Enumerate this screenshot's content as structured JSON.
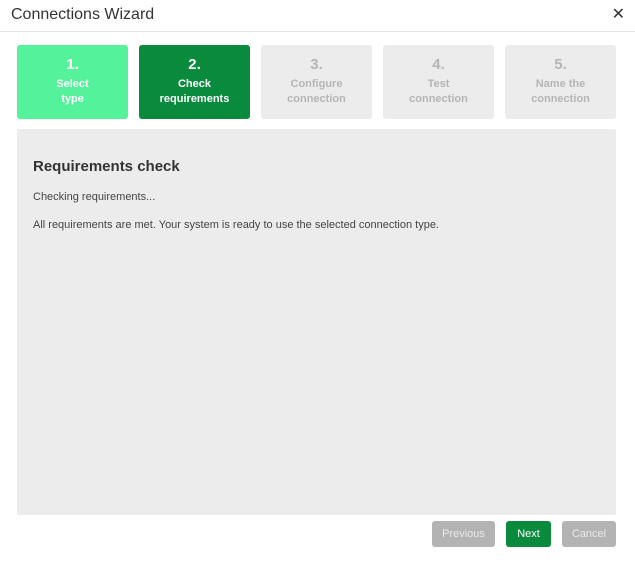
{
  "window": {
    "title": "Connections Wizard",
    "close_icon": "close-icon",
    "close_glyph": "✕"
  },
  "steps": [
    {
      "number": "1.",
      "label": "Select type",
      "state": "done"
    },
    {
      "number": "2.",
      "label": "Check requirements",
      "state": "active"
    },
    {
      "number": "3.",
      "label": "Configure connection",
      "state": "pending"
    },
    {
      "number": "4.",
      "label": "Test connection",
      "state": "pending"
    },
    {
      "number": "5.",
      "label": "Name the connection",
      "state": "pending"
    }
  ],
  "panel": {
    "heading": "Requirements check",
    "status": "Checking requirements...",
    "result": "All requirements are met. Your system is ready to use the selected connection type."
  },
  "buttons": {
    "previous": "Previous",
    "next": "Next",
    "cancel": "Cancel"
  },
  "colors": {
    "step_done": "#55f29c",
    "step_active": "#0a8a3c",
    "step_pending": "#ececec",
    "primary_button": "#0a8a3c",
    "disabled_button": "#b3b3b3"
  }
}
